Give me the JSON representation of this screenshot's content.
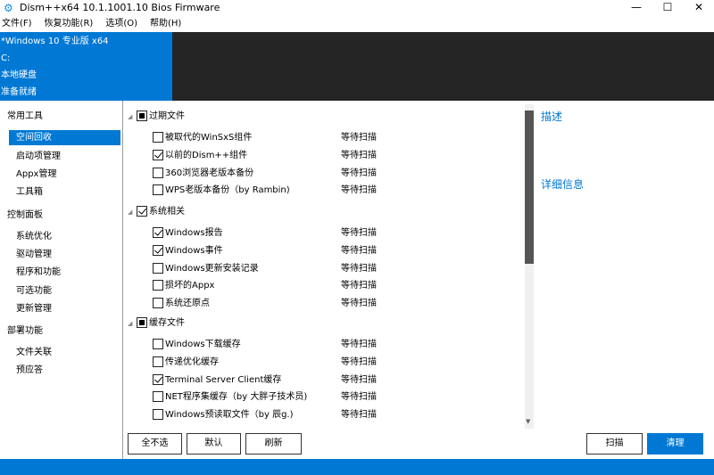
{
  "window": {
    "title": "Dism++x64 10.1.1001.10 Bios Firmware",
    "minimize": "—",
    "maximize": "☐",
    "close": "✕"
  },
  "menu": [
    "文件(F)",
    "恢复功能(R)",
    "选项(O)",
    "帮助(H)"
  ],
  "header": {
    "os": "*Windows 10 专业版 x64",
    "drive": "C:",
    "disk": "本地硬盘",
    "state": "准备就绪"
  },
  "sidebar": [
    {
      "label": "常用工具",
      "type": "group"
    },
    {
      "label": "空间回收",
      "type": "item",
      "selected": true
    },
    {
      "label": "启动项管理",
      "type": "item"
    },
    {
      "label": "Appx管理",
      "type": "item"
    },
    {
      "label": "工具箱",
      "type": "item"
    },
    {
      "label": "控制面板",
      "type": "group"
    },
    {
      "label": "系统优化",
      "type": "item"
    },
    {
      "label": "驱动管理",
      "type": "item"
    },
    {
      "label": "程序和功能",
      "type": "item"
    },
    {
      "label": "可选功能",
      "type": "item"
    },
    {
      "label": "更新管理",
      "type": "item"
    },
    {
      "label": "部署功能",
      "type": "group"
    },
    {
      "label": "文件关联",
      "type": "item"
    },
    {
      "label": "预应答",
      "type": "item"
    }
  ],
  "groups": [
    {
      "label": "过期文件",
      "state": "partial",
      "items": [
        {
          "label": "被取代的WinSxS组件",
          "checked": false,
          "status": "等待扫描"
        },
        {
          "label": "以前的Dism++组件",
          "checked": true,
          "status": "等待扫描"
        },
        {
          "label": "360浏览器老版本备份",
          "checked": false,
          "status": "等待扫描"
        },
        {
          "label": "WPS老版本备份（by Rambin)",
          "checked": false,
          "status": "等待扫描"
        }
      ]
    },
    {
      "label": "系统相关",
      "state": "checked",
      "items": [
        {
          "label": "Windows报告",
          "checked": true,
          "status": "等待扫描"
        },
        {
          "label": "Windows事件",
          "checked": true,
          "status": "等待扫描"
        },
        {
          "label": "Windows更新安装记录",
          "checked": false,
          "status": "等待扫描"
        },
        {
          "label": "损坏的Appx",
          "checked": false,
          "status": "等待扫描"
        },
        {
          "label": "系统还原点",
          "checked": false,
          "status": "等待扫描"
        }
      ]
    },
    {
      "label": "缓存文件",
      "state": "partial",
      "items": [
        {
          "label": "Windows下载缓存",
          "checked": false,
          "status": "等待扫描"
        },
        {
          "label": "传递优化缓存",
          "checked": false,
          "status": "等待扫描"
        },
        {
          "label": "Terminal Server Client缓存",
          "checked": true,
          "status": "等待扫描"
        },
        {
          "label": "NET程序集缓存（by 大胖子技术员)",
          "checked": false,
          "status": "等待扫描"
        },
        {
          "label": "Windows预读取文件（by 辰g.)",
          "checked": false,
          "status": "等待扫描"
        }
      ]
    }
  ],
  "right": {
    "desc": "描述",
    "details": "详细信息"
  },
  "buttons": {
    "none": "全不选",
    "default": "默认",
    "refresh": "刷新",
    "scan": "扫描",
    "clean": "清理"
  }
}
